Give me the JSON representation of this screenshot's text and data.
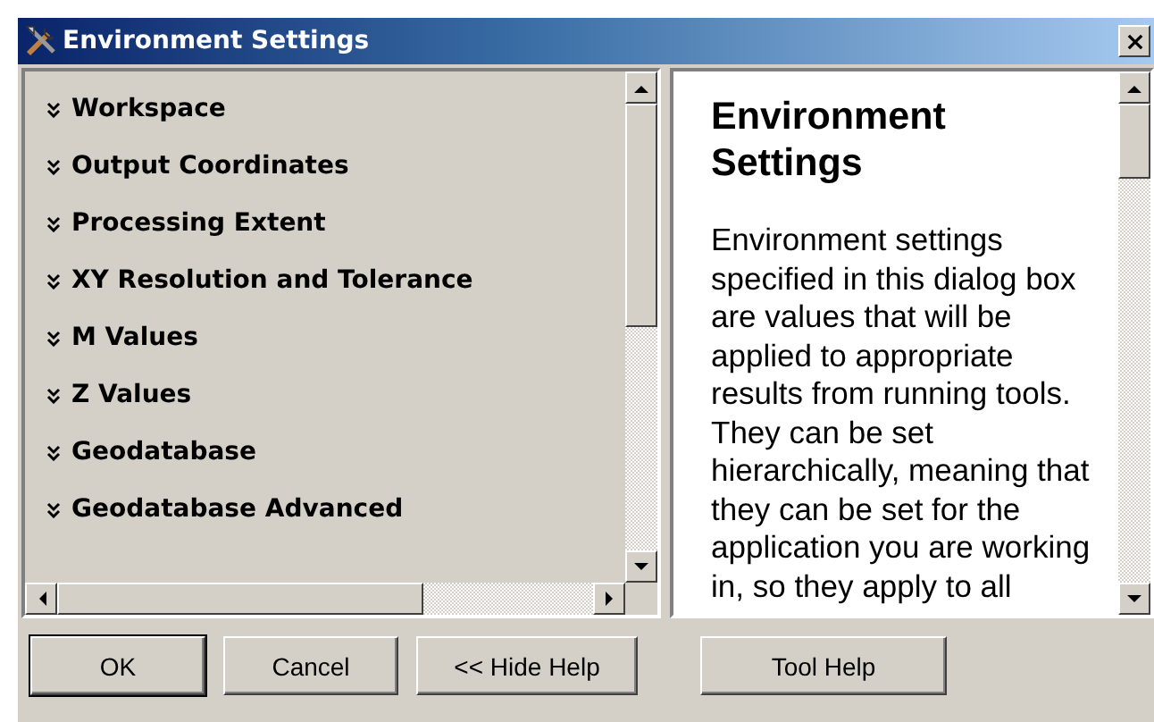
{
  "window": {
    "title": "Environment Settings"
  },
  "settings": [
    {
      "label": "Workspace"
    },
    {
      "label": "Output Coordinates"
    },
    {
      "label": "Processing Extent"
    },
    {
      "label": "XY Resolution and Tolerance"
    },
    {
      "label": "M Values"
    },
    {
      "label": "Z Values"
    },
    {
      "label": "Geodatabase"
    },
    {
      "label": "Geodatabase Advanced"
    }
  ],
  "help": {
    "title": "Environment Settings",
    "text": "Environment settings specified in this dialog box are values that will be applied to appropriate results from running tools. They can be set hierarchically, meaning that they can be set for the application you are working in, so they apply to all"
  },
  "buttons": [
    {
      "label": "OK",
      "kind": "default"
    },
    {
      "label": "Cancel",
      "kind": "normal"
    },
    {
      "label": "<< Hide Help",
      "kind": "normal"
    },
    {
      "label": "Tool Help",
      "kind": "spaced"
    }
  ]
}
